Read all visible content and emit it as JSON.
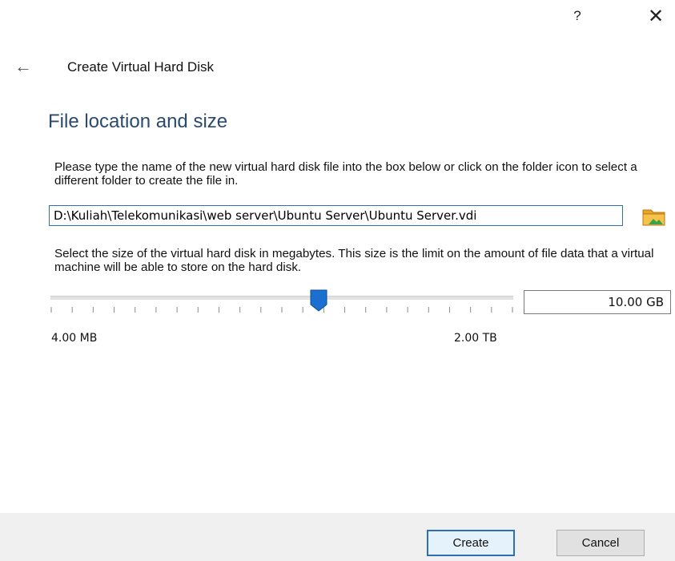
{
  "titlebar": {
    "help_label": "?",
    "close_label": "✕"
  },
  "header": {
    "back_icon": "left-arrow-icon",
    "title": "Create Virtual Hard Disk"
  },
  "section": {
    "title": "File location and size",
    "location_text": "Please type the name of the new virtual hard disk file into the box below or click on the folder icon to select a different folder to create the file in.",
    "file_path": "D:\\Kuliah\\Telekomunikasi\\web server\\Ubuntu Server\\Ubuntu Server.vdi",
    "folder_icon": "folder-icon",
    "size_text": "Select the size of the virtual hard disk in megabytes. This size is the limit on the amount of file data that a virtual machine will be able to store on the hard disk."
  },
  "slider": {
    "min_label": "4.00 MB",
    "max_label": "2.00 TB",
    "position_fraction": 0.58
  },
  "size_field": {
    "value": "10.00 GB"
  },
  "buttons": {
    "create": "Create",
    "cancel": "Cancel"
  },
  "colors": {
    "accent": "#2f6fb8",
    "section_title": "#2b4a6f",
    "thumb": "#1a6fd0",
    "folder": "#e8a329"
  }
}
